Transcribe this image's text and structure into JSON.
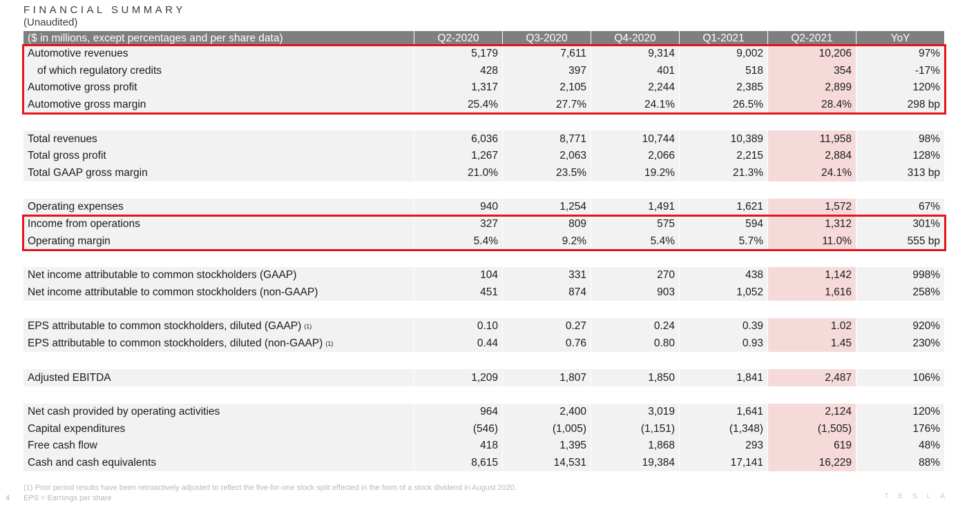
{
  "title": "FINANCIAL SUMMARY",
  "subtitle": "(Unaudited)",
  "header": [
    "($ in millions, except percentages and per share data)",
    "Q2-2020",
    "Q3-2020",
    "Q4-2020",
    "Q1-2021",
    "Q2-2021",
    "YoY"
  ],
  "groups": [
    [
      {
        "label": "Automotive revenues",
        "values": [
          "5,179",
          "7,611",
          "9,314",
          "9,002",
          "10,206",
          "97%"
        ]
      },
      {
        "label": "of which regulatory credits",
        "indent": true,
        "values": [
          "428",
          "397",
          "401",
          "518",
          "354",
          "-17%"
        ]
      },
      {
        "label": "Automotive gross profit",
        "values": [
          "1,317",
          "2,105",
          "2,244",
          "2,385",
          "2,899",
          "120%"
        ]
      },
      {
        "label": "Automotive gross margin",
        "values": [
          "25.4%",
          "27.7%",
          "24.1%",
          "26.5%",
          "28.4%",
          "298 bp"
        ]
      }
    ],
    [
      {
        "label": "Total revenues",
        "values": [
          "6,036",
          "8,771",
          "10,744",
          "10,389",
          "11,958",
          "98%"
        ]
      },
      {
        "label": "Total gross profit",
        "values": [
          "1,267",
          "2,063",
          "2,066",
          "2,215",
          "2,884",
          "128%"
        ]
      },
      {
        "label": "Total GAAP gross margin",
        "values": [
          "21.0%",
          "23.5%",
          "19.2%",
          "21.3%",
          "24.1%",
          "313 bp"
        ]
      }
    ],
    [
      {
        "label": "Operating expenses",
        "values": [
          "940",
          "1,254",
          "1,491",
          "1,621",
          "1,572",
          "67%"
        ]
      },
      {
        "label": "Income from operations",
        "values": [
          "327",
          "809",
          "575",
          "594",
          "1,312",
          "301%"
        ]
      },
      {
        "label": "Operating margin",
        "values": [
          "5.4%",
          "9.2%",
          "5.4%",
          "5.7%",
          "11.0%",
          "555 bp"
        ]
      }
    ],
    [
      {
        "label": "Net income attributable to common stockholders (GAAP)",
        "values": [
          "104",
          "331",
          "270",
          "438",
          "1,142",
          "998%"
        ]
      },
      {
        "label": "Net income attributable to common stockholders (non-GAAP)",
        "values": [
          "451",
          "874",
          "903",
          "1,052",
          "1,616",
          "258%"
        ]
      }
    ],
    [
      {
        "label": "EPS attributable to common stockholders, diluted (GAAP)",
        "sup": "(1)",
        "values": [
          "0.10",
          "0.27",
          "0.24",
          "0.39",
          "1.02",
          "920%"
        ]
      },
      {
        "label": "EPS attributable to common stockholders, diluted (non-GAAP)",
        "sup": "(1)",
        "values": [
          "0.44",
          "0.76",
          "0.80",
          "0.93",
          "1.45",
          "230%"
        ]
      }
    ],
    [
      {
        "label": "Adjusted EBITDA",
        "values": [
          "1,209",
          "1,807",
          "1,850",
          "1,841",
          "2,487",
          "106%"
        ]
      }
    ],
    [
      {
        "label": "Net cash provided by operating activities",
        "values": [
          "964",
          "2,400",
          "3,019",
          "1,641",
          "2,124",
          "120%"
        ]
      },
      {
        "label": "Capital expenditures",
        "values": [
          "(546)",
          "(1,005)",
          "(1,151)",
          "(1,348)",
          "(1,505)",
          "176%"
        ]
      },
      {
        "label": "Free cash flow",
        "values": [
          "418",
          "1,395",
          "1,868",
          "293",
          "619",
          "48%"
        ]
      },
      {
        "label": "Cash and cash equivalents",
        "values": [
          "8,615",
          "14,531",
          "19,384",
          "17,141",
          "16,229",
          "88%"
        ]
      }
    ]
  ],
  "footnote1": "(1) Prior period results have been retroactively adjusted to reflect the five-for-one stock split effected in the form of a stock dividend in August 2020.",
  "footnote2": "EPS = Earnings per share",
  "page_number": "4",
  "logo_text": "TESLA",
  "highlight_color": "#f6dada",
  "box_color": "#e3141b"
}
